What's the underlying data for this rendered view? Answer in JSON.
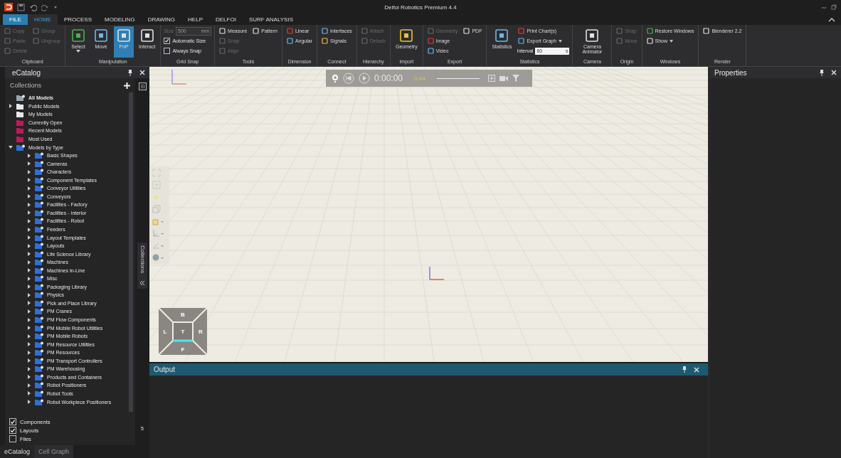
{
  "title_bar": {
    "title": "Delfoi Robotics Premium 4.4"
  },
  "ribbon_tabs": [
    {
      "label": "FILE",
      "kind": "file",
      "selected": false
    },
    {
      "label": "HOME",
      "kind": "tab",
      "selected": true
    },
    {
      "label": "PROCESS",
      "kind": "tab",
      "selected": false
    },
    {
      "label": "MODELING",
      "kind": "tab",
      "selected": false
    },
    {
      "label": "DRAWING",
      "kind": "tab",
      "selected": false
    },
    {
      "label": "HELP",
      "kind": "tab",
      "selected": false
    },
    {
      "label": "DELFOI",
      "kind": "tab",
      "selected": false
    },
    {
      "label": "SURF ANALYSIS",
      "kind": "tab",
      "selected": false
    }
  ],
  "ribbon_groups": [
    {
      "label": "Clipboard",
      "columns": [
        [
          {
            "kind": "small",
            "label": "Copy",
            "disabled": true
          },
          {
            "kind": "small",
            "label": "Paste",
            "disabled": true
          },
          {
            "kind": "small",
            "label": "Delete",
            "disabled": true
          }
        ],
        [
          {
            "kind": "small",
            "label": "Group",
            "disabled": true
          },
          {
            "kind": "small",
            "label": "Ungroup",
            "disabled": true
          }
        ]
      ]
    },
    {
      "label": "Manipulation",
      "columns": [
        [
          {
            "kind": "large",
            "label": "Select",
            "disabled": false,
            "selected": false,
            "menu": true
          }
        ],
        [
          {
            "kind": "large",
            "label": "Move",
            "disabled": false,
            "selected": false,
            "menu": false
          }
        ],
        [
          {
            "kind": "large",
            "label": "PnP",
            "disabled": false,
            "selected": true,
            "menu": false
          }
        ],
        [
          {
            "kind": "large",
            "label": "Interact",
            "disabled": false,
            "selected": false,
            "menu": false
          }
        ]
      ]
    },
    {
      "label": "Grid Snap",
      "columns": [
        [
          {
            "kind": "field",
            "label": "Size",
            "value": "500",
            "unit": "mm",
            "disabled": true
          },
          {
            "kind": "check",
            "label": "Automatic Size",
            "checked": true
          },
          {
            "kind": "check",
            "label": "Always Snap",
            "checked": false
          }
        ]
      ]
    },
    {
      "label": "Tools",
      "columns": [
        [
          {
            "kind": "small",
            "label": "Measure",
            "disabled": false
          },
          {
            "kind": "small",
            "label": "Snap",
            "disabled": true
          },
          {
            "kind": "small",
            "label": "Align",
            "disabled": true
          }
        ],
        [
          {
            "kind": "small",
            "label": "Pattern",
            "disabled": false
          }
        ]
      ]
    },
    {
      "label": "Dimension",
      "columns": [
        [
          {
            "kind": "small",
            "label": "Linear",
            "disabled": false
          },
          {
            "kind": "small",
            "label": "Angular",
            "disabled": false
          }
        ]
      ]
    },
    {
      "label": "Connect",
      "columns": [
        [
          {
            "kind": "small",
            "label": "Interfaces",
            "disabled": false
          },
          {
            "kind": "small",
            "label": "Signals",
            "disabled": false
          }
        ]
      ]
    },
    {
      "label": "Hierarchy",
      "columns": [
        [
          {
            "kind": "small",
            "label": "Attach",
            "disabled": true
          },
          {
            "kind": "small",
            "label": "Detach",
            "disabled": true
          }
        ]
      ]
    },
    {
      "label": "Import",
      "columns": [
        [
          {
            "kind": "large",
            "label": "Geometry",
            "disabled": false,
            "selected": false,
            "menu": false
          }
        ]
      ]
    },
    {
      "label": "Export",
      "columns": [
        [
          {
            "kind": "small",
            "label": "Geometry",
            "disabled": true
          },
          {
            "kind": "small",
            "label": "Image",
            "disabled": false
          },
          {
            "kind": "small",
            "label": "Video",
            "disabled": false
          }
        ],
        [
          {
            "kind": "small",
            "label": "PDF",
            "disabled": false
          }
        ]
      ]
    },
    {
      "label": "Statistics",
      "columns": [
        [
          {
            "kind": "large",
            "label": "Statistics",
            "disabled": false,
            "selected": false,
            "menu": false
          }
        ],
        [
          {
            "kind": "small",
            "label": "Print Chart(s)",
            "disabled": false
          },
          {
            "kind": "small",
            "label": "Export Graph",
            "disabled": false,
            "menu": true
          },
          {
            "kind": "field",
            "label": "Interval",
            "value": "60",
            "unit": "s",
            "disabled": false
          }
        ]
      ]
    },
    {
      "label": "Camera",
      "columns": [
        [
          {
            "kind": "large",
            "label": "Camera Animator",
            "disabled": false,
            "selected": false,
            "menu": false
          }
        ]
      ]
    },
    {
      "label": "Origin",
      "columns": [
        [
          {
            "kind": "small",
            "label": "Snap",
            "disabled": true
          },
          {
            "kind": "small",
            "label": "Move",
            "disabled": true
          }
        ]
      ]
    },
    {
      "label": "Windows",
      "columns": [
        [
          {
            "kind": "small",
            "label": "Restore Windows",
            "disabled": false
          },
          {
            "kind": "small",
            "label": "Show",
            "disabled": false,
            "menu": true
          }
        ]
      ]
    },
    {
      "label": "Render",
      "columns": [
        [
          {
            "kind": "small",
            "label": "Blenderer 2.2",
            "disabled": false
          }
        ]
      ]
    }
  ],
  "catalog": {
    "title": "eCatalog",
    "collections_label": "Collections",
    "tree": [
      {
        "label": "All Models",
        "kind": "all",
        "color": "#9aa4b0"
      },
      {
        "label": "Public Models",
        "kind": "folder",
        "color": "#e8e8e8",
        "expanded": false
      },
      {
        "label": "My Models",
        "kind": "folder",
        "color": "#e8e8e8"
      },
      {
        "label": "Currently Open",
        "kind": "folder",
        "color": "#c2185b"
      },
      {
        "label": "Recent Models",
        "kind": "folder",
        "color": "#c2185b"
      },
      {
        "label": "Most Used",
        "kind": "folder",
        "color": "#c2185b"
      },
      {
        "label": "Models by Type",
        "kind": "type",
        "color": "#2f6fd6",
        "expanded": true,
        "children": [
          {
            "label": "Basic Shapes",
            "expanded": false
          },
          {
            "label": "Cameras",
            "expanded": false
          },
          {
            "label": "Characters",
            "expanded": false
          },
          {
            "label": "Component Templates",
            "expanded": false
          },
          {
            "label": "Conveyor Utilities",
            "expanded": false
          },
          {
            "label": "Conveyors",
            "expanded": false
          },
          {
            "label": "Facilities - Factory",
            "expanded": false
          },
          {
            "label": "Facilities - Interior",
            "expanded": false
          },
          {
            "label": "Facilities - Robot",
            "expanded": false
          },
          {
            "label": "Feeders",
            "expanded": false
          },
          {
            "label": "Layout Templates",
            "expanded": false
          },
          {
            "label": "Layouts",
            "expanded": false
          },
          {
            "label": "Life Science Library",
            "expanded": false
          },
          {
            "label": "Machines",
            "expanded": false
          },
          {
            "label": "Machines In-Line",
            "expanded": false
          },
          {
            "label": "Misc",
            "expanded": false
          },
          {
            "label": "Packaging Library",
            "expanded": false
          },
          {
            "label": "Physics",
            "expanded": false
          },
          {
            "label": "Pick and Place Library",
            "expanded": false
          },
          {
            "label": "PM Cranes",
            "expanded": false
          },
          {
            "label": "PM Flow Components",
            "expanded": false
          },
          {
            "label": "PM Mobile Robot Utilities",
            "expanded": false
          },
          {
            "label": "PM Mobile Robots",
            "expanded": false
          },
          {
            "label": "PM Resource Utilities",
            "expanded": false
          },
          {
            "label": "PM Resources",
            "expanded": false
          },
          {
            "label": "PM Transport Controllers",
            "expanded": false
          },
          {
            "label": "PM Warehousing",
            "expanded": false
          },
          {
            "label": "Products and Containers",
            "expanded": false
          },
          {
            "label": "Robot Positioners",
            "expanded": false
          },
          {
            "label": "Robot Tools",
            "expanded": false
          },
          {
            "label": "Robot Workpiece Positioners",
            "expanded": false
          }
        ]
      }
    ],
    "filters": [
      {
        "label": "Components",
        "checked": true
      },
      {
        "label": "Layouts",
        "checked": true
      },
      {
        "label": "Files",
        "checked": false
      }
    ],
    "side_tab": "Collections",
    "side_mark": "5",
    "tabs": [
      {
        "label": "eCatalog",
        "selected": true
      },
      {
        "label": "Cell Graph",
        "selected": false
      }
    ]
  },
  "viewport": {
    "time": "0:00:00",
    "speed": "0.04",
    "view_cube": [
      "B",
      "L",
      "T",
      "R",
      "F"
    ]
  },
  "output": {
    "title": "Output"
  },
  "properties": {
    "title": "Properties"
  }
}
